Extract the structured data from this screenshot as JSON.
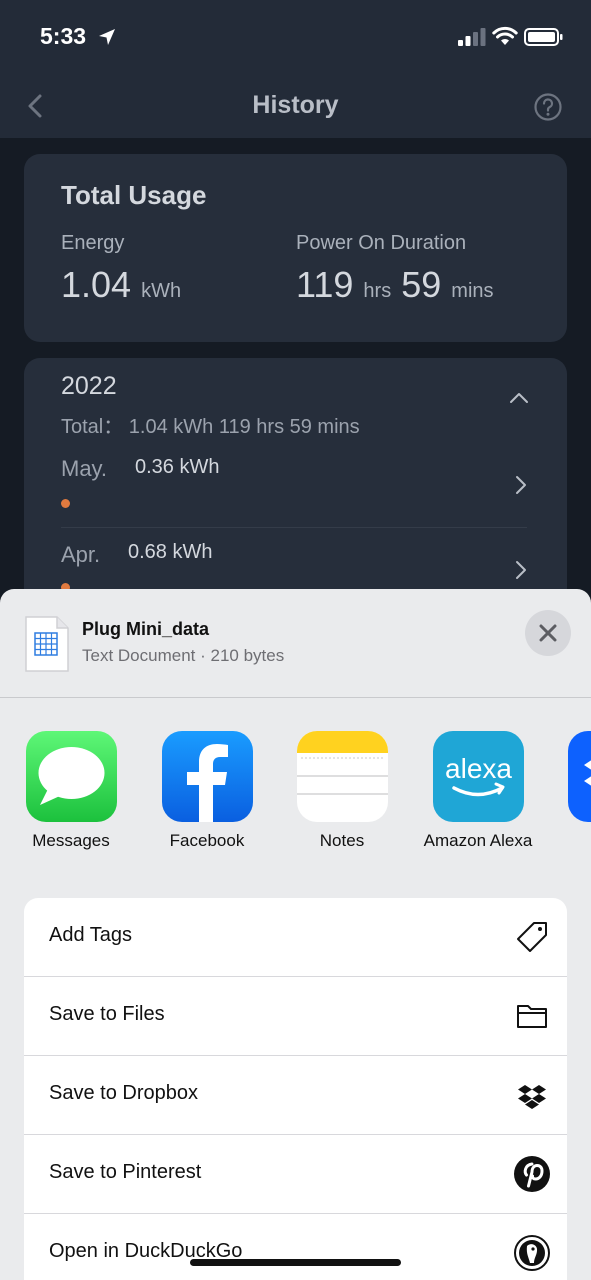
{
  "status_bar": {
    "time": "5:33"
  },
  "nav": {
    "title": "History"
  },
  "total_usage": {
    "title": "Total Usage",
    "energy_label": "Energy",
    "energy_value": "1.04",
    "energy_unit": "kWh",
    "duration_label": "Power On Duration",
    "hours_value": "119",
    "hours_unit": "hrs",
    "mins_value": "59",
    "mins_unit": "mins"
  },
  "year_section": {
    "year": "2022",
    "total_text": "Total： 1.04 kWh   119 hrs 59 mins",
    "months": [
      {
        "month": "May.",
        "value": "0.36 kWh"
      },
      {
        "month": "Apr.",
        "value": "0.68 kWh"
      }
    ]
  },
  "share_sheet": {
    "file_name": "Plug Mini_data",
    "file_info": "Text Document · 210 bytes",
    "apps": [
      {
        "label": "Messages",
        "icon": "messages-icon"
      },
      {
        "label": "Facebook",
        "icon": "facebook-icon"
      },
      {
        "label": "Notes",
        "icon": "notes-icon"
      },
      {
        "label": "Amazon Alexa",
        "icon": "alexa-icon",
        "icon_text": "alexa"
      },
      {
        "label": "D",
        "icon": "dropbox-app-icon"
      }
    ],
    "actions": [
      {
        "label": "Add Tags",
        "icon": "tag-icon"
      },
      {
        "label": "Save to Files",
        "icon": "folder-icon"
      },
      {
        "label": "Save to Dropbox",
        "icon": "dropbox-icon"
      },
      {
        "label": "Save to Pinterest",
        "icon": "pinterest-icon"
      },
      {
        "label": "Open in DuckDuckGo",
        "icon": "duckduckgo-icon"
      }
    ]
  },
  "colors": {
    "background": "#151b24",
    "header": "#232b38",
    "card": "#262e3b",
    "accent_dot": "#e07a3f",
    "sheet": "#eaebed"
  }
}
